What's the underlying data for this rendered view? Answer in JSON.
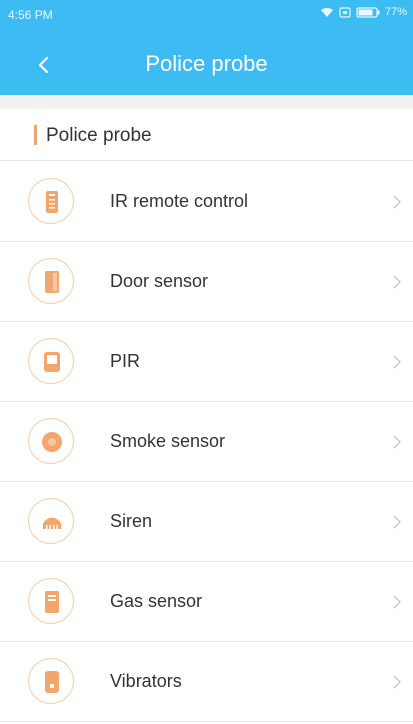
{
  "status_bar": {
    "time": "4:56 PM",
    "battery_percent": "77%",
    "icons": [
      "wifi-icon",
      "sim-icon",
      "battery-icon"
    ]
  },
  "header": {
    "title": "Police probe",
    "back_icon": "back-arrow-icon"
  },
  "section": {
    "title": "Police probe"
  },
  "devices": [
    {
      "label": "IR remote control",
      "icon": "ir-remote-icon"
    },
    {
      "label": "Door sensor",
      "icon": "door-sensor-icon"
    },
    {
      "label": "PIR",
      "icon": "pir-icon"
    },
    {
      "label": "Smoke sensor",
      "icon": "smoke-sensor-icon"
    },
    {
      "label": "Siren",
      "icon": "siren-icon"
    },
    {
      "label": "Gas sensor",
      "icon": "gas-sensor-icon"
    },
    {
      "label": "Vibrators",
      "icon": "vibrators-icon"
    }
  ],
  "colors": {
    "header_bg": "#3dbbf3",
    "accent_orange": "#f2a56d",
    "icon_ring": "#f5cfad",
    "divider": "#e8e8e8",
    "text": "#333333"
  }
}
